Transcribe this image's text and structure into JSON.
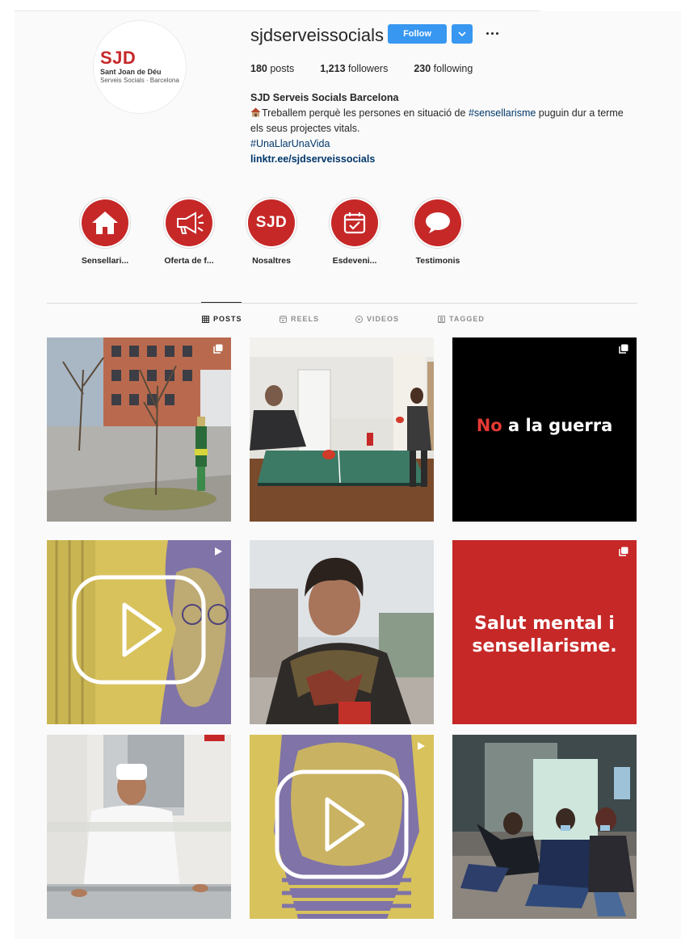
{
  "profile": {
    "username": "sjdserveissocials",
    "follow_label": "Follow",
    "avatar": {
      "logo_text": "SJD",
      "line1": "Sant Joan de Déu",
      "line2": "Serveis Socials · Barcelona"
    },
    "stats": {
      "posts_count": "180",
      "posts_label": "posts",
      "followers_count": "1,213",
      "followers_label": "followers",
      "following_count": "230",
      "following_label": "following"
    },
    "bio": {
      "full_name": "SJD Serveis Socials Barcelona",
      "line1_pre": "Treballem perquè les persones en situació de ",
      "line1_tag": "#sensellarisme",
      "line1_post": " puguin dur a terme els seus projectes vitals.",
      "hashtag": "#UnaLlarUnaVida",
      "link": "linktr.ee/sjdserveissocials"
    }
  },
  "highlights": [
    {
      "label": "Sensellari...",
      "icon": "house-icon"
    },
    {
      "label": "Oferta de f...",
      "icon": "megaphone-icon"
    },
    {
      "label": "Nosaltres",
      "icon": "sjd-logo-icon",
      "text": "SJD"
    },
    {
      "label": "Esdeveni...",
      "icon": "calendar-icon"
    },
    {
      "label": "Testimonis",
      "icon": "speech-bubble-icon"
    }
  ],
  "tabs": [
    {
      "label": "POSTS",
      "icon": "grid-icon",
      "active": true
    },
    {
      "label": "REELS",
      "icon": "reels-icon",
      "active": false
    },
    {
      "label": "VIDEOS",
      "icon": "video-play-icon",
      "active": false
    },
    {
      "label": "TAGGED",
      "icon": "tagged-icon",
      "active": false
    }
  ],
  "posts": [
    {
      "type": "photo",
      "badge": "multi-photo-icon",
      "subject": "street tree planting"
    },
    {
      "type": "photo",
      "badge": "none",
      "subject": "ping pong"
    },
    {
      "type": "text",
      "badge": "multi-photo-icon",
      "text_red": "No",
      "text_white": "a la guerra"
    },
    {
      "type": "video",
      "badge": "video-icon"
    },
    {
      "type": "photo",
      "badge": "none",
      "subject": "portrait woman scarf"
    },
    {
      "type": "text",
      "badge": "multi-photo-icon",
      "line1": "Salut mental i",
      "line2": "sensellarisme."
    },
    {
      "type": "photo",
      "badge": "none",
      "subject": "cook at counter"
    },
    {
      "type": "video",
      "badge": "video-icon"
    },
    {
      "type": "photo",
      "badge": "none",
      "subject": "group posing"
    }
  ],
  "colors": {
    "brand_red": "#c62828",
    "follow_blue": "#3897f0",
    "link_blue": "#00376b",
    "video_yellow": "#d8c25c",
    "video_purple": "#7f73a8"
  }
}
